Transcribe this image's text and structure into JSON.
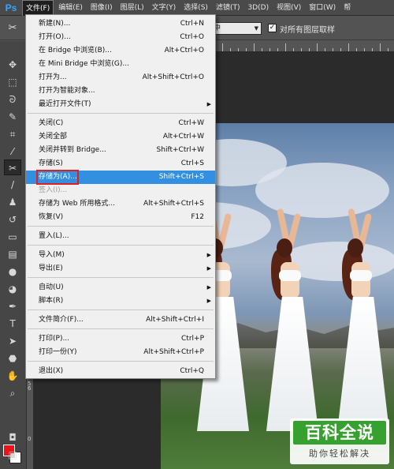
{
  "menubar": {
    "logo": "Ps",
    "items": [
      "文件(F)",
      "编辑(E)",
      "图像(I)",
      "图层(L)",
      "文字(Y)",
      "选择(S)",
      "滤镜(T)",
      "3D(D)",
      "视图(V)",
      "窗口(W)",
      "帮"
    ]
  },
  "options": {
    "select_value": "中",
    "checkbox_label": "对所有图层取样",
    "checkbox_checked": "✓"
  },
  "ruler": {
    "left_labels": [
      "5",
      "6",
      "0"
    ]
  },
  "file_menu": [
    {
      "label": "新建(N)...",
      "shortcut": "Ctrl+N"
    },
    {
      "label": "打开(O)...",
      "shortcut": "Ctrl+O"
    },
    {
      "label": "在 Bridge 中浏览(B)...",
      "shortcut": "Alt+Ctrl+O"
    },
    {
      "label": "在 Mini Bridge 中浏览(G)...",
      "shortcut": ""
    },
    {
      "label": "打开为...",
      "shortcut": "Alt+Shift+Ctrl+O"
    },
    {
      "label": "打开为智能对象...",
      "shortcut": ""
    },
    {
      "label": "最近打开文件(T)",
      "shortcut": ""
    },
    {
      "label": "关闭(C)",
      "shortcut": "Ctrl+W"
    },
    {
      "label": "关闭全部",
      "shortcut": "Alt+Ctrl+W"
    },
    {
      "label": "关闭并转到 Bridge...",
      "shortcut": "Shift+Ctrl+W"
    },
    {
      "label": "存储(S)",
      "shortcut": "Ctrl+S"
    },
    {
      "label": "存储为(A)...",
      "shortcut": "Shift+Ctrl+S"
    },
    {
      "label": "签入(I)...",
      "shortcut": ""
    },
    {
      "label": "存储为 Web 所用格式...",
      "shortcut": "Alt+Shift+Ctrl+S"
    },
    {
      "label": "恢复(V)",
      "shortcut": "F12"
    },
    {
      "label": "置入(L)...",
      "shortcut": ""
    },
    {
      "label": "导入(M)",
      "shortcut": ""
    },
    {
      "label": "导出(E)",
      "shortcut": ""
    },
    {
      "label": "自动(U)",
      "shortcut": ""
    },
    {
      "label": "脚本(R)",
      "shortcut": ""
    },
    {
      "label": "文件简介(F)...",
      "shortcut": "Alt+Shift+Ctrl+I"
    },
    {
      "label": "打印(P)...",
      "shortcut": "Ctrl+P"
    },
    {
      "label": "打印一份(Y)",
      "shortcut": "Alt+Shift+Ctrl+P"
    },
    {
      "label": "退出(X)",
      "shortcut": "Ctrl+Q"
    }
  ],
  "watermark": {
    "title": "百科全说",
    "subtitle": "助你轻松解决"
  },
  "colors": {
    "highlight": "#3390e0",
    "foreground_swatch": "#e8141a",
    "background_swatch": "#ffffff",
    "watermark_green": "#36a12e"
  }
}
